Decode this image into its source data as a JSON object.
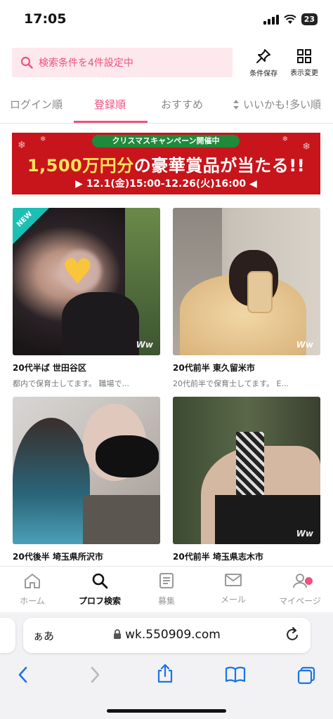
{
  "status_bar": {
    "time": "17:05",
    "battery": "23"
  },
  "search": {
    "text": "検索条件を4件設定中"
  },
  "toolbar": {
    "save_label": "条件保存",
    "display_label": "表示変更"
  },
  "tabs": [
    {
      "label": "ログイン順"
    },
    {
      "label": "登録順",
      "active": true
    },
    {
      "label": "おすすめ"
    },
    {
      "label": "いいかも!多い順"
    }
  ],
  "banner": {
    "pill": "クリスマスキャンペーン開催中",
    "headline_prefix": "1,500万円分",
    "headline_suffix": "の豪華賞品が当たる!!",
    "dates": "12.1(金)15:00-12.26(火)16:00"
  },
  "profiles": [
    {
      "location": "20代半ば 世田谷区",
      "description": "都内で保育士してます。 職場で...",
      "badge": "NEW",
      "watermark": "Ww"
    },
    {
      "location": "20代前半 東久留米市",
      "description": "20代前半で保育士してます。 E...",
      "watermark": "Ww"
    },
    {
      "location": "20代後半 埼玉県所沢市",
      "description": ""
    },
    {
      "location": "20代前半 埼玉県志木市",
      "description": "",
      "watermark": "Ww"
    }
  ],
  "bottom_nav": [
    {
      "label": "ホーム",
      "icon": "home-icon"
    },
    {
      "label": "プロフ検索",
      "icon": "search-icon",
      "active": true
    },
    {
      "label": "募集",
      "icon": "document-icon"
    },
    {
      "label": "メール",
      "icon": "mail-icon"
    },
    {
      "label": "マイページ",
      "icon": "user-icon"
    }
  ],
  "browser": {
    "aa": "ぁあ",
    "url": "wk.550909.com"
  },
  "colors": {
    "accent": "#f0517f",
    "banner_red": "#c8141b",
    "banner_green": "#1f8a3a",
    "new_badge": "#1bbfb3"
  }
}
